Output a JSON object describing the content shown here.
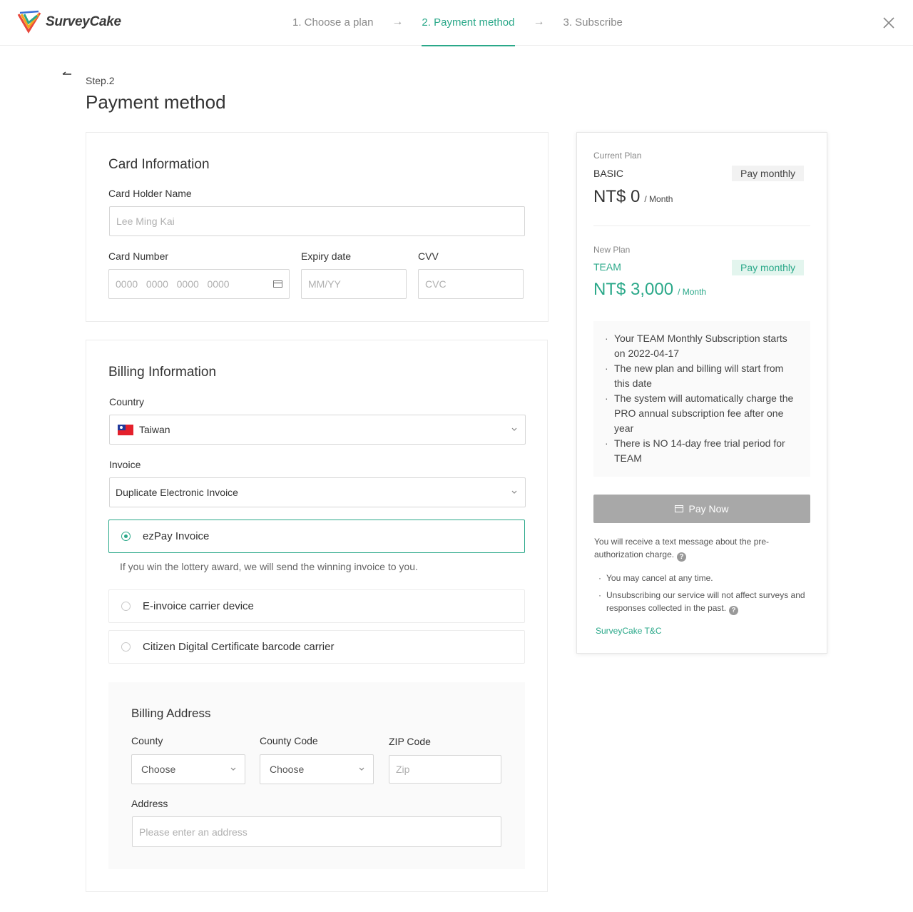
{
  "brand": {
    "name": "SurveyCake"
  },
  "steps": [
    {
      "label": "1. Choose a plan"
    },
    {
      "label": "2. Payment method"
    },
    {
      "label": "3. Subscribe"
    }
  ],
  "step_arrow": "→",
  "page": {
    "step_label": "Step.2",
    "title": "Payment method"
  },
  "card_info": {
    "title": "Card Information",
    "holder_label": "Card Holder Name",
    "holder_placeholder": "Lee Ming Kai",
    "number_label": "Card Number",
    "number_placeholder": "0000   0000   0000   0000",
    "expiry_label": "Expiry date",
    "expiry_placeholder": "MM/YY",
    "cvv_label": "CVV",
    "cvv_placeholder": "CVC"
  },
  "billing": {
    "title": "Billing Information",
    "country_label": "Country",
    "country_value": "Taiwan",
    "invoice_label": "Invoice",
    "invoice_value": "Duplicate Electronic Invoice",
    "options": [
      {
        "label": "ezPay Invoice",
        "selected": true
      },
      {
        "label": "E-invoice carrier device",
        "selected": false
      },
      {
        "label": "Citizen Digital Certificate barcode carrier",
        "selected": false
      }
    ],
    "hint": "If you win the lottery award, we will send the winning invoice to you.",
    "address": {
      "title": "Billing Address",
      "county_label": "County",
      "county_value": "Choose",
      "county_code_label": "County Code",
      "county_code_value": "Choose",
      "zip_label": "ZIP Code",
      "zip_placeholder": "Zip",
      "address_label": "Address",
      "address_placeholder": "Please enter an address"
    }
  },
  "summary": {
    "current": {
      "label": "Current Plan",
      "plan": "BASIC",
      "badge": "Pay monthly",
      "price": "NT$ 0",
      "per": "/ Month"
    },
    "new": {
      "label": "New Plan",
      "plan": "TEAM",
      "badge": "Pay monthly",
      "price": "NT$ 3,000",
      "per": "/ Month"
    },
    "notes": [
      "Your TEAM Monthly Subscription starts on 2022-04-17",
      "The new plan and billing will start from this date",
      "The system will automatically charge the PRO annual subscription fee after one year",
      "There is NO 14-day free trial period for TEAM"
    ],
    "pay_button": "Pay Now",
    "sms_note": "You will receive a text message about the pre-authorization charge.",
    "bullets": [
      "You may cancel at any time.",
      "Unsubscribing our service will not affect surveys and responses collected in the past."
    ],
    "tc_link": "SurveyCake T&C"
  },
  "colors": {
    "accent": "#2aa889",
    "button_disabled": "#a8a8a8"
  },
  "icons": {
    "close": "close-icon",
    "back": "back-arrow-icon",
    "card": "credit-card-icon",
    "chevron": "chevron-down-icon",
    "help": "question-mark-icon",
    "flag": "taiwan-flag-icon"
  }
}
